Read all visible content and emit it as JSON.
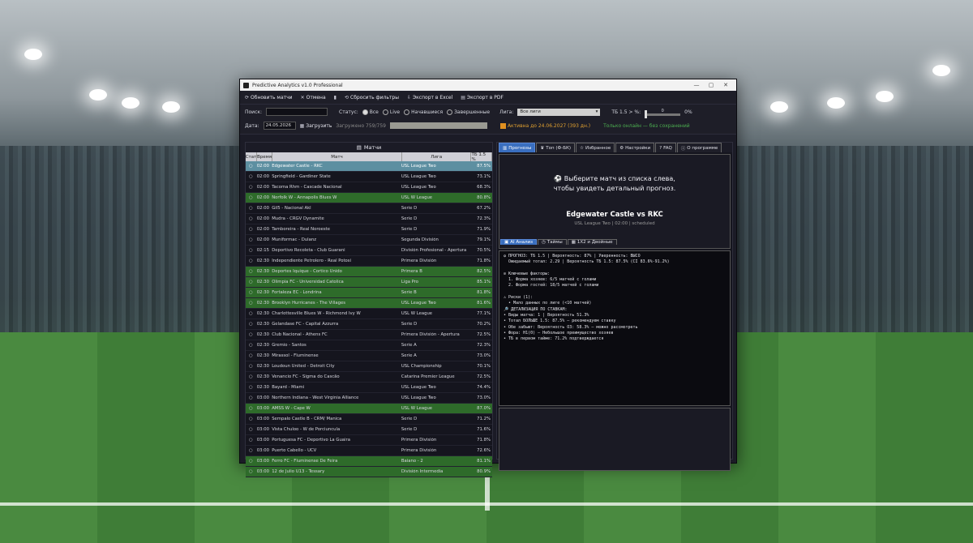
{
  "window": {
    "title": "Predictive Analytics v1.0 Professional",
    "controls": {
      "minimize": "—",
      "maximize": "▢",
      "close": "✕"
    }
  },
  "toolbar": {
    "refresh": "Обновить матчи",
    "stop": "Отмена",
    "reset_filters": "Сбросить фильтры",
    "export_excel": "Экспорт в Excel",
    "export_pdf": "Экспорт в PDF"
  },
  "filters": {
    "search_label": "Поиск:",
    "search_value": "",
    "status_label": "Статус:",
    "status_options": [
      "Все",
      "Live",
      "Начавшиеся",
      "Завершенные"
    ],
    "league_label": "Лига:",
    "league_value": "Все лиги",
    "tb_label": "ТБ 1.5 > %:",
    "tb_value": "0",
    "tb_percent": "0%",
    "date_label": "Дата:",
    "date_value": "24.05.2026",
    "load_button": "Загрузить",
    "load_status": "Загружено 759/759",
    "progress": 1.0,
    "active_text": "Активна до 24.06.2027 (393 дн.)",
    "online_text": "Только онлайн — без сохранений"
  },
  "matches_panel": {
    "title": "Матчи",
    "columns": [
      "Стат",
      "Время",
      "Матч",
      "Лига",
      "ТБ 1.5 %"
    ],
    "rows": [
      {
        "status": "○",
        "time": "02:00",
        "match": "Edgewater Castle - RKC",
        "league": "USL League Two",
        "pct": "87.5%",
        "style": "sel"
      },
      {
        "status": "○",
        "time": "02:00",
        "match": "Springfield - Gardiner State",
        "league": "USL League Two",
        "pct": "73.1%",
        "style": "d"
      },
      {
        "status": "○",
        "time": "02:00",
        "match": "Tacoma Rhm - Cascade Nacional",
        "league": "USL League Two",
        "pct": "68.3%",
        "style": "d"
      },
      {
        "status": "○",
        "time": "02:00",
        "match": "Norfolk W - Annapolis Blues W",
        "league": "USL W League",
        "pct": "80.8%",
        "style": "g"
      },
      {
        "status": "○",
        "time": "02:00",
        "match": "Gil5 - Nacional Akl",
        "league": "Serie D",
        "pct": "67.2%",
        "style": "d"
      },
      {
        "status": "○",
        "time": "02:00",
        "match": "Mudra - CRGV Dynamite",
        "league": "Serie D",
        "pct": "72.3%",
        "style": "d"
      },
      {
        "status": "○",
        "time": "02:00",
        "match": "Tamboreira - Real Noroeste",
        "league": "Serie D",
        "pct": "71.9%",
        "style": "d"
      },
      {
        "status": "○",
        "time": "02:00",
        "match": "Muniformac - Dulanz",
        "league": "Segunda División",
        "pct": "79.1%",
        "style": "d"
      },
      {
        "status": "○",
        "time": "02:15",
        "match": "Deportivo Recoleta - Club Guarani",
        "league": "División Profesional - Apertura",
        "pct": "70.5%",
        "style": "d"
      },
      {
        "status": "○",
        "time": "02:30",
        "match": "Independiente Petrolero - Real Potosí",
        "league": "Primera División",
        "pct": "71.8%",
        "style": "d"
      },
      {
        "status": "○",
        "time": "02:30",
        "match": "Deportes Iquique - Cortico Unido",
        "league": "Primera B",
        "pct": "82.5%",
        "style": "g"
      },
      {
        "status": "○",
        "time": "02:30",
        "match": "Olimpia FC - Universidad Catolica",
        "league": "Liga Pro",
        "pct": "85.1%",
        "style": "g"
      },
      {
        "status": "○",
        "time": "02:30",
        "match": "Fortaleza EC - Londrina",
        "league": "Serie B",
        "pct": "81.8%",
        "style": "g"
      },
      {
        "status": "○",
        "time": "02:30",
        "match": "Brooklyn Hurricanes - The Villages",
        "league": "USL League Two",
        "pct": "81.6%",
        "style": "g"
      },
      {
        "status": "○",
        "time": "02:30",
        "match": "Charlottesville Blues W - Richmond Ivy W",
        "league": "USL W League",
        "pct": "77.1%",
        "style": "d"
      },
      {
        "status": "○",
        "time": "02:30",
        "match": "Gelandase FC - Capital Azzurra",
        "league": "Serie D",
        "pct": "70.2%",
        "style": "d"
      },
      {
        "status": "○",
        "time": "02:30",
        "match": "Club Nacional - Athens FC",
        "league": "Primera División - Apertura",
        "pct": "72.5%",
        "style": "d"
      },
      {
        "status": "○",
        "time": "02:30",
        "match": "Gremio - Santos",
        "league": "Serie A",
        "pct": "72.3%",
        "style": "d"
      },
      {
        "status": "○",
        "time": "02:30",
        "match": "Mirassol - Fluminense",
        "league": "Serie A",
        "pct": "73.0%",
        "style": "d"
      },
      {
        "status": "○",
        "time": "02:30",
        "match": "Loudoun United - Detroit City",
        "league": "USL Championship",
        "pct": "70.1%",
        "style": "d"
      },
      {
        "status": "○",
        "time": "02:30",
        "match": "Venancio FC - Sigma do Cascâo",
        "league": "Catarina Premier League",
        "pct": "72.5%",
        "style": "d"
      },
      {
        "status": "○",
        "time": "02:30",
        "match": "Bayard - Miami",
        "league": "USL League Two",
        "pct": "74.4%",
        "style": "d"
      },
      {
        "status": "○",
        "time": "03:00",
        "match": "Northern Indiana - West Virginia Alliance",
        "league": "USL League Two",
        "pct": "73.0%",
        "style": "d"
      },
      {
        "status": "○",
        "time": "03:00",
        "match": "AMSS W - Cape W",
        "league": "USL W League",
        "pct": "87.0%",
        "style": "g"
      },
      {
        "status": "○",
        "time": "03:00",
        "match": "Sempalo Castle B - CRM/ Manica",
        "league": "Serie D",
        "pct": "71.2%",
        "style": "d"
      },
      {
        "status": "○",
        "time": "03:00",
        "match": "Vista Chuloo - W de Porciuncula",
        "league": "Serie D",
        "pct": "71.6%",
        "style": "d"
      },
      {
        "status": "○",
        "time": "03:00",
        "match": "Portuguesa FC - Deportivo La Guaira",
        "league": "Primera División",
        "pct": "71.8%",
        "style": "d"
      },
      {
        "status": "○",
        "time": "03:00",
        "match": "Puerto Cabello - UCV",
        "league": "Primera División",
        "pct": "72.6%",
        "style": "d"
      },
      {
        "status": "○",
        "time": "03:00",
        "match": "Ferro FC - Fluminense De Feira",
        "league": "Baiano - 2",
        "pct": "81.1%",
        "style": "g"
      },
      {
        "status": "○",
        "time": "03:00",
        "match": "12 de Julio U13 - Tessary",
        "league": "División Intermedia",
        "pct": "80.9%",
        "style": "g"
      }
    ]
  },
  "details_panel": {
    "tabs": [
      "Прогнозы",
      "Топ (Ф-БК)",
      "Избранное",
      "Настройки",
      "FAQ",
      "О программе"
    ],
    "prompt_line1": "Выберите матч из списка слева,",
    "prompt_line2": "чтобы увидеть детальный прогноз.",
    "match_title": "Edgewater Castle vs RKC",
    "match_subtitle": "USL League Two | 02:00 | scheduled",
    "sub_tabs": [
      "AI Анализ",
      "Таймы",
      "1Х2 и Двойные"
    ],
    "console_lines": [
      "✪ ПРОГНОЗ: ТБ 1.5 | Вероятность: 87% | Уверенность: ВЫСО",
      "  Ожидаемый тотал: 2.29 | Вероятность ТБ 1.5: 87.5% (CI 83.6%-91.2%)",
      "",
      "⊘ Ключевые факторы:",
      "  1. Форма хозяев: 6/5 матчей с голами",
      "  2. Форма гостей: 18/5 матчей с голами",
      "",
      "⚠ Риски (1):",
      "  • Мало данных по лиге (<10 матчей)",
      "🔎 ДЕТАЛИЗАЦИЯ ПО СТАВКАМ:",
      "• Виды матча: 1 | Вероятность 51.3%",
      "• Тотал БОЛЬШЕ 1.5: 87.5% — рекомендуем ставку",
      "• Обе забьют: Вероятность ОЗ: 58.3% — можно рассмотреть",
      "• Фора: Н1(0) — Небольшое преимущество хозяев",
      "• ТБ в первом тайме: 71.2% подтверждается"
    ]
  },
  "colors": {
    "accent": "#3a6fc0",
    "highlight_row": "#2e6b2a",
    "selected_row": "#5d8fa1",
    "license_text": "#e0a030"
  }
}
